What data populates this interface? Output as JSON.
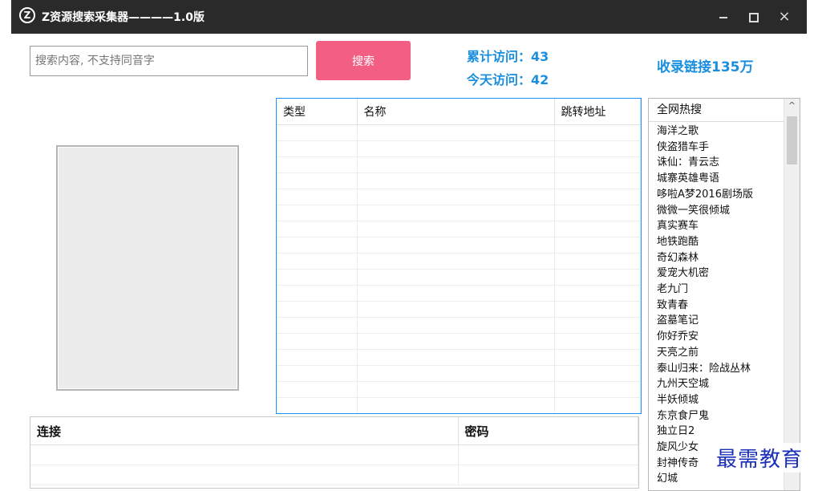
{
  "window": {
    "title": "Z资源搜索采集器————1.0版",
    "logo_letter": "Z",
    "minimize_icon": "minimize-icon",
    "maximize_icon": "maximize-icon",
    "close_glyph": "×"
  },
  "search": {
    "value": "",
    "placeholder": "搜索内容, 不支持同音字",
    "button_label": "搜索"
  },
  "stats": {
    "total_visits": "累计访问：43",
    "today_visits": "今天访问：42",
    "indexed_links": "收录链接135万"
  },
  "results_table": {
    "columns": [
      "类型",
      "名称",
      "跳转地址"
    ],
    "empty_rows": 18
  },
  "links_table": {
    "columns": [
      "连接",
      "密码"
    ]
  },
  "hot_search": {
    "header": "全网热搜",
    "scroll_up_glyph": "^",
    "items": [
      "海洋之歌",
      "侠盗猎车手",
      "诛仙：青云志",
      "城寨英雄粤语",
      "哆啦A梦2016剧场版",
      "微微一笑很倾城",
      "真实赛车",
      "地铁跑酷",
      "奇幻森林",
      "爱宠大机密",
      "老九门",
      "致青春",
      "盗墓笔记",
      "你好乔安",
      "天亮之前",
      "泰山归来：险战丛林",
      "九州天空城",
      "半妖倾城",
      "东京食尸鬼",
      "独立日2",
      "旋风少女",
      "封神传奇",
      "幻城"
    ]
  },
  "watermark": "最需教育"
}
